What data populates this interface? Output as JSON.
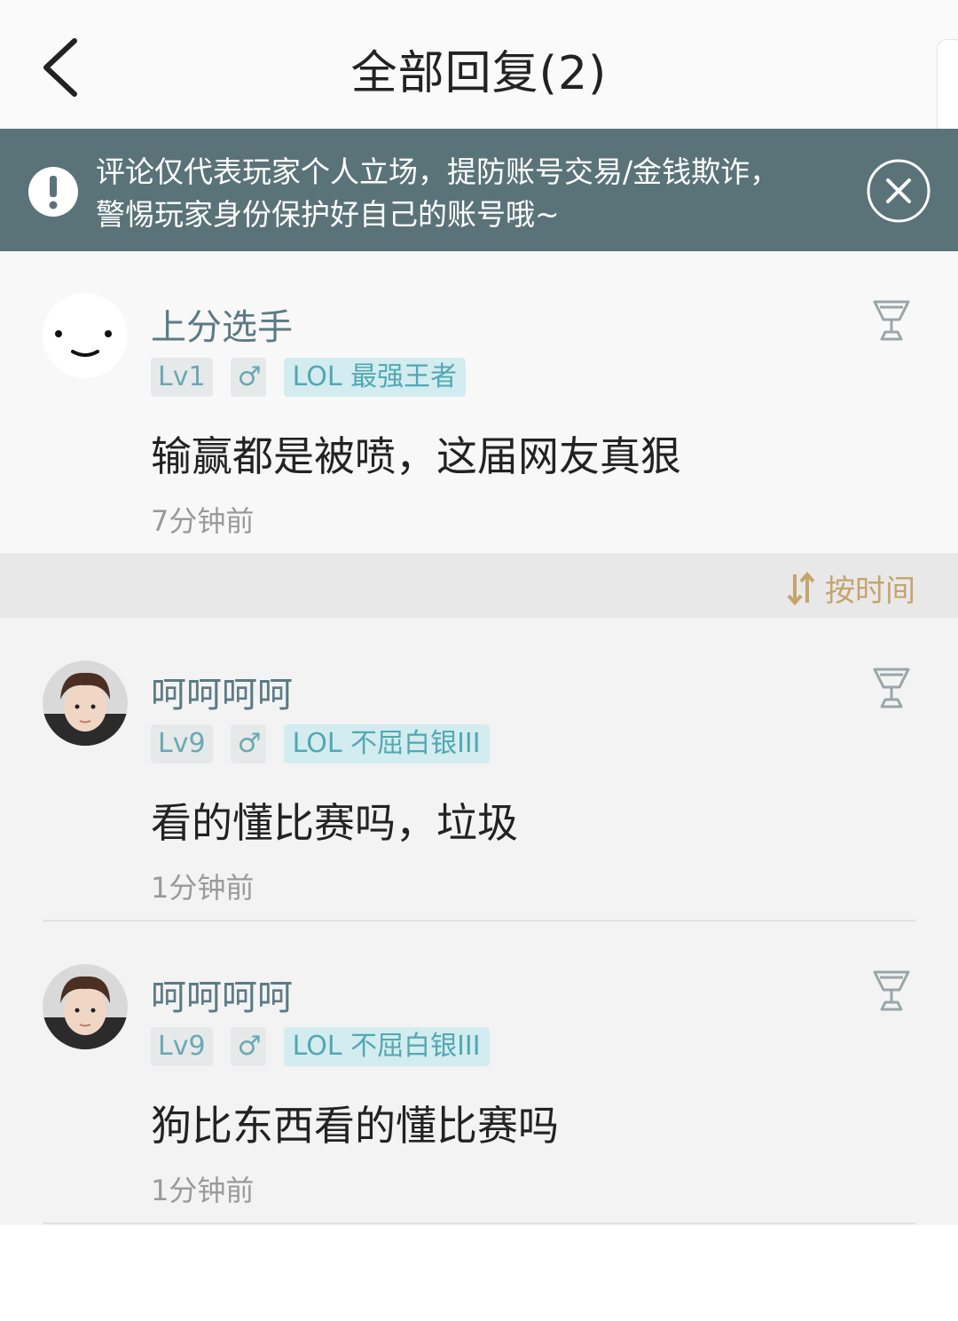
{
  "header": {
    "title": "全部回复(2)"
  },
  "notice": {
    "line1": "评论仅代表玩家个人立场，提防账号交易/金钱欺诈，",
    "line2": "警惕玩家身份保护好自己的账号哦~"
  },
  "main_comment": {
    "username": "上分选手",
    "level": "Lv1",
    "gender": "♂",
    "rank": "LOL 最强王者",
    "text": "输赢都是被喷，这届网友真狠",
    "time": "7分钟前"
  },
  "sort": {
    "label": "按时间"
  },
  "replies": [
    {
      "username": "呵呵呵呵",
      "level": "Lv9",
      "gender": "♂",
      "rank": "LOL 不屈白银III",
      "text": "看的懂比赛吗，垃圾",
      "time": "1分钟前"
    },
    {
      "username": "呵呵呵呵",
      "level": "Lv9",
      "gender": "♂",
      "rank": "LOL 不屈白银III",
      "text": "狗比东西看的懂比赛吗",
      "time": "1分钟前"
    }
  ],
  "colors": {
    "notice_bg": "#5a7379",
    "username": "#5b7a84",
    "rank_badge_bg": "#d3ecef",
    "rank_badge_text": "#51a8b3",
    "sort_text": "#c4a56c"
  }
}
